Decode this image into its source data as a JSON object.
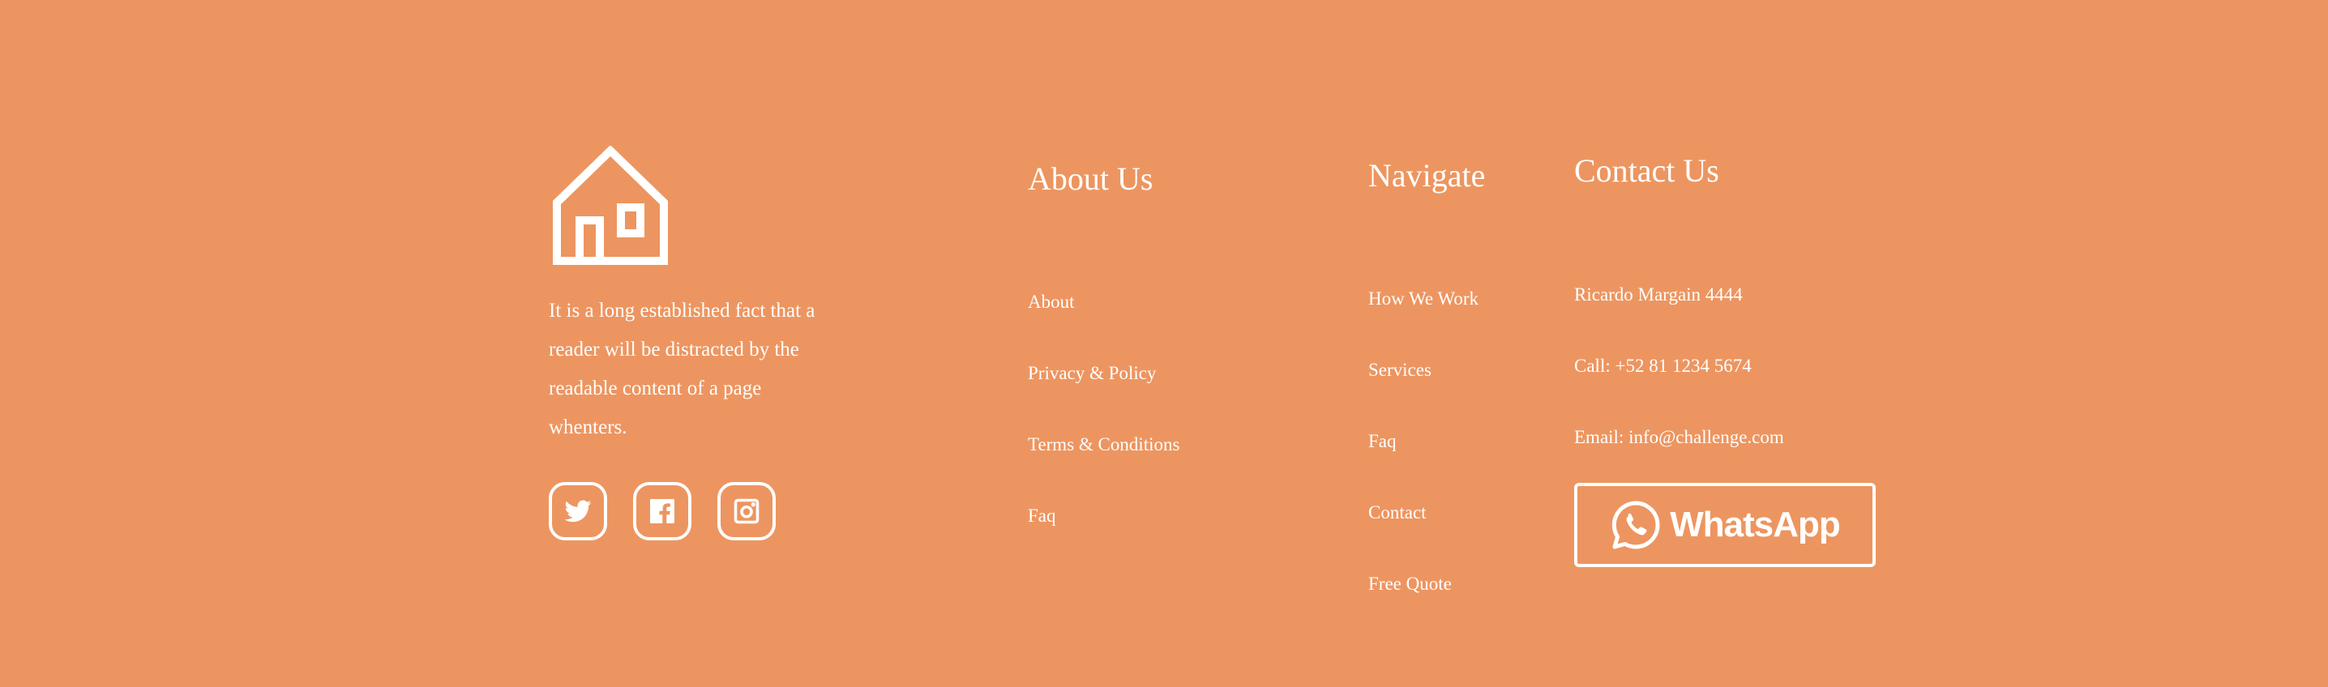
{
  "brand": {
    "logo_icon": "house-icon",
    "description": "It is a long established fact that a reader will be distracted by the readable content of a page whenters."
  },
  "socials": [
    {
      "icon": "twitter-icon",
      "label": "Twitter"
    },
    {
      "icon": "facebook-icon",
      "label": "Facebook"
    },
    {
      "icon": "instagram-icon",
      "label": "Instagram"
    }
  ],
  "about": {
    "heading": "About Us",
    "links": [
      "About",
      "Privacy & Policy",
      "Terms & Conditions",
      "Faq"
    ]
  },
  "navigate": {
    "heading": "Navigate",
    "links": [
      "How We Work",
      "Services",
      "Faq",
      "Contact",
      "Free Quote"
    ]
  },
  "contact": {
    "heading": "Contact Us",
    "address": "Ricardo Margain 4444",
    "phone": "Call: +52 81 1234 5674",
    "email": "Email: info@challenge.com",
    "whatsapp_label": "WhatsApp",
    "whatsapp_icon": "whatsapp-icon"
  },
  "colors": {
    "background": "#ED9560",
    "foreground": "#FFFFFF"
  }
}
